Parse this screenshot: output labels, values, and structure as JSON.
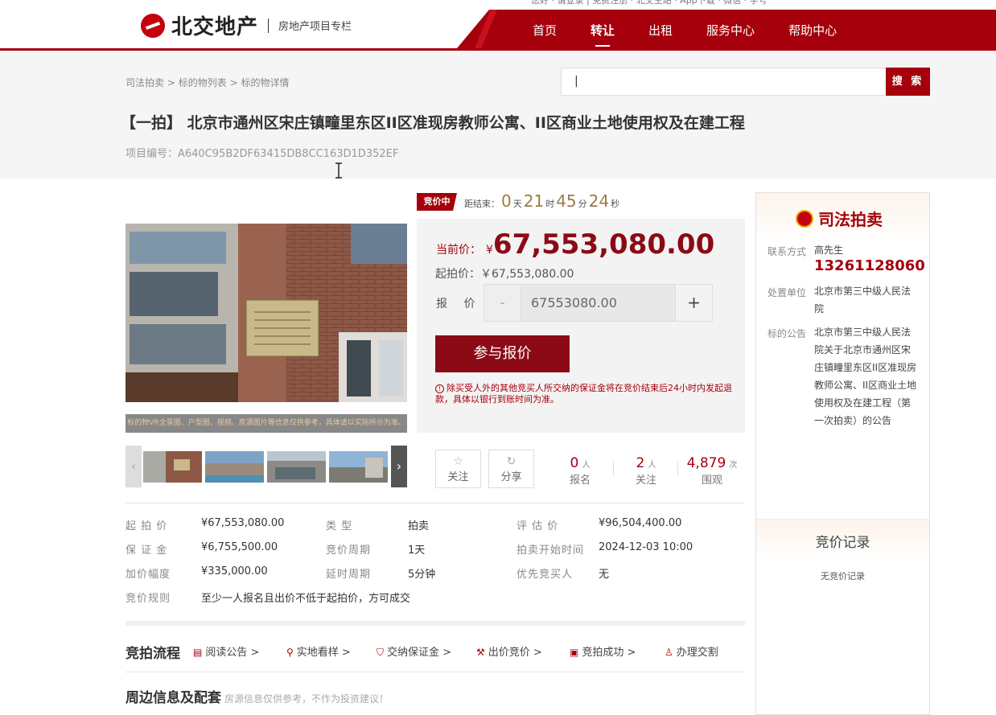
{
  "header": {
    "logo_text": "北交地产",
    "logo_sub": "房地产项目专栏",
    "top_strip": "您好 · 请登录 | 免费注册 · 北交主站 · App下载 · 微信 · 字号",
    "nav": [
      "首页",
      "转让",
      "出租",
      "服务中心",
      "帮助中心"
    ],
    "nav_active_index": 1
  },
  "breadcrumb": [
    "司法拍卖",
    "标的物列表",
    "标的物详情"
  ],
  "breadcrumb_sep": ">",
  "search": {
    "value": "|",
    "button": "搜 索"
  },
  "title": "【一拍】 北京市通州区宋庄镇疃里东区II区准现房教师公寓、II区商业土地使用权及在建工程",
  "project_no": "项目编号：A640C95B2DF63415DB8CC163D1D352EF",
  "gallery": {
    "caption": "标的物VR全景图、户型图、视频、房源图片等信息仅供参考，具体请以实际所示为准。",
    "prev": "‹",
    "next": "›"
  },
  "auction": {
    "status": "竞价中",
    "countdown_label": "距结束：",
    "days": "0",
    "days_unit": "天",
    "hours": "21",
    "hours_unit": "时",
    "minutes": "45",
    "minutes_unit": "分",
    "seconds": "24",
    "seconds_unit": "秒",
    "current_label": "当前价：",
    "currency": "¥",
    "current_price": "67,553,080.00",
    "start_line": "起拍价：￥67,553,080.00",
    "bid_label": "报 价：",
    "bid_minus": "-",
    "bid_value": "67553080.00",
    "bid_plus": "+",
    "bid_button": "参与报价",
    "notice": "除买受人外的其他竞买人所交纳的保证金将在竞价结束后24小时内发起退款，具体以银行到账时间为准。"
  },
  "actions": {
    "follow": "关注",
    "share": "分享",
    "stats": [
      {
        "value": "0",
        "unit": "人",
        "label": "报名"
      },
      {
        "value": "2",
        "unit": "人",
        "label": "关注"
      },
      {
        "value": "4,879",
        "unit": "次",
        "label": "围观"
      }
    ]
  },
  "info": {
    "col1": [
      {
        "k": "起 拍 价",
        "v": "¥67,553,080.00"
      },
      {
        "k": "保 证 金",
        "v": "¥6,755,500.00"
      },
      {
        "k": "加价幅度",
        "v": "¥335,000.00"
      },
      {
        "k": "竞价规则",
        "v": "至少一人报名且出价不低于起拍价，方可成交"
      }
    ],
    "col2": [
      {
        "k": "类 型",
        "v": "拍卖"
      },
      {
        "k": "竞价周期",
        "v": "1天"
      },
      {
        "k": "延时周期",
        "v": "5分钟"
      }
    ],
    "col3": [
      {
        "k": "评 估 价",
        "v": "¥96,504,400.00"
      },
      {
        "k": "拍卖开始时间",
        "v": "2024-12-03 10:00"
      },
      {
        "k": "优先竞买人",
        "v": "无"
      }
    ]
  },
  "process": {
    "title": "竞拍流程",
    "steps": [
      "阅读公告 >",
      "实地看样 >",
      "交纳保证金 >",
      "出价竞价 >",
      "竞拍成功 >",
      "办理交割"
    ]
  },
  "nearby": {
    "title": "周边信息及配套",
    "note": "房源信息仅供参考，不作为投资建议！"
  },
  "side": {
    "title": "司法拍卖",
    "contact_label": "联系方式",
    "contact_name": "高先生",
    "phone": "13261128060",
    "unit_label": "处置单位",
    "unit_value": "北京市第三中级人民法院",
    "notice_label": "标的公告",
    "notice_value": "北京市第三中级人民法院关于北京市通州区宋庄镇疃里东区II区准现房教师公寓、II区商业土地使用权及在建工程（第一次拍卖）的公告",
    "records_title": "竞价记录",
    "records_empty": "无竞价记录"
  },
  "colors": {
    "brand": "#a5000b",
    "price": "#8b0a16",
    "countdown": "#9b7b45"
  }
}
